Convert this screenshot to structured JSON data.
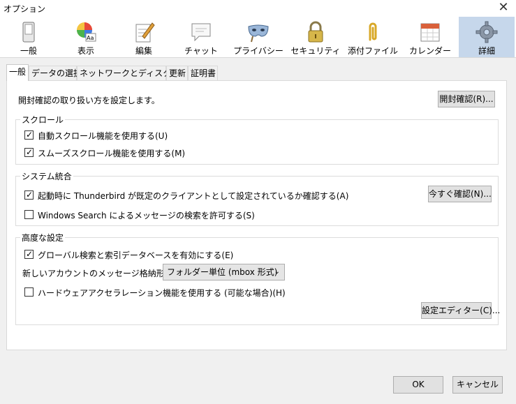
{
  "window": {
    "title": "オプション",
    "close_glyph": "✕"
  },
  "toolbar": [
    {
      "name": "general",
      "label": "一般",
      "icon": "switch-icon"
    },
    {
      "name": "display",
      "label": "表示",
      "icon": "color-wheel-icon"
    },
    {
      "name": "composition",
      "label": "編集",
      "icon": "pencil-paper-icon"
    },
    {
      "name": "chat",
      "label": "チャット",
      "icon": "chat-bubble-icon"
    },
    {
      "name": "privacy",
      "label": "プライバシー",
      "icon": "mask-icon"
    },
    {
      "name": "security",
      "label": "セキュリティ",
      "icon": "padlock-icon"
    },
    {
      "name": "attachments",
      "label": "添付ファイル",
      "icon": "paperclip-icon"
    },
    {
      "name": "calendar",
      "label": "カレンダー",
      "icon": "calendar-icon"
    },
    {
      "name": "advanced",
      "label": "詳細",
      "icon": "gear-icon",
      "active": true
    }
  ],
  "tabs": [
    {
      "label": "一般",
      "active": true
    },
    {
      "label": "データの選択"
    },
    {
      "label": "ネットワークとディスク領域"
    },
    {
      "label": "更新"
    },
    {
      "label": "証明書"
    }
  ],
  "receipts": {
    "text": "開封確認の取り扱い方を設定します。",
    "button": "開封確認(R)..."
  },
  "scroll": {
    "title": "スクロール",
    "auto": {
      "label": "自動スクロール機能を使用する(U)",
      "checked": true
    },
    "smooth": {
      "label": "スムーズスクロール機能を使用する(M)",
      "checked": true
    }
  },
  "system": {
    "title": "システム統合",
    "default_check": {
      "label": "起動時に Thunderbird が既定のクライアントとして設定されているか確認する(A)",
      "checked": true
    },
    "check_now": "今すぐ確認(N)...",
    "windows_search": {
      "label": "Windows Search によるメッセージの検索を許可する(S)",
      "checked": false
    }
  },
  "advanced": {
    "title": "高度な設定",
    "global_search": {
      "label": "グローバル検索と索引データベースを有効にする(E)",
      "checked": true
    },
    "store_label": "新しいアカウントのメッセージ格納形式(T):",
    "store_value": "フォルダー単位 (mbox 形式)",
    "hw_accel": {
      "label": "ハードウェアアクセラレーション機能を使用する (可能な場合)(H)",
      "checked": false
    },
    "config_editor": "設定エディター(C)..."
  },
  "footer": {
    "ok": "OK",
    "cancel": "キャンセル"
  },
  "colors": {
    "active_tab_bg": "#c6d7eb",
    "window_bg": "#f0f0f0"
  },
  "check_glyph": "✓",
  "arrow_glyph": "⌄"
}
